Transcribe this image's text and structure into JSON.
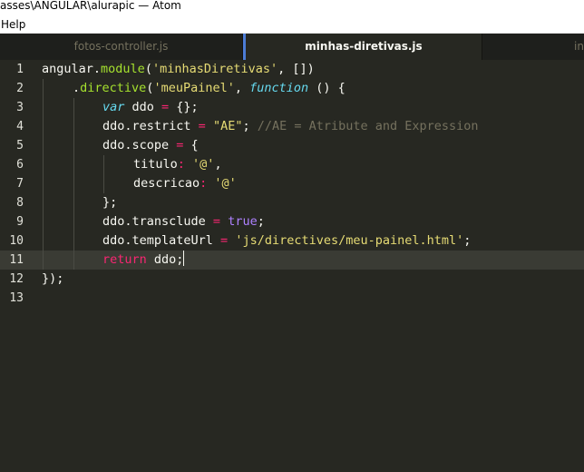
{
  "window": {
    "title": "asses\\ANGULAR\\alurapic — Atom"
  },
  "menu": {
    "items": [
      "Help"
    ]
  },
  "tabs": [
    {
      "label": "fotos-controller.js",
      "active": false
    },
    {
      "label": "minhas-diretivas.js",
      "active": true
    },
    {
      "label": "in",
      "active": false
    }
  ],
  "editor": {
    "line_numbers": [
      "1",
      "2",
      "3",
      "4",
      "5",
      "6",
      "7",
      "8",
      "9",
      "10",
      "11",
      "12",
      "13"
    ],
    "active_line": "11",
    "code": {
      "l1": [
        "angular",
        ".",
        "module",
        "(",
        "'minhasDiretivas'",
        ", [])"
      ],
      "l2": [
        ".",
        "directive",
        "(",
        "'meuPainel'",
        ", ",
        "function",
        " () {"
      ],
      "l3": [
        "var",
        " ddo ",
        "=",
        " {};"
      ],
      "l4": [
        "ddo.restrict ",
        "=",
        " ",
        "\"AE\"",
        "; ",
        "//AE = Atribute and Expression"
      ],
      "l5": [
        "ddo.scope ",
        "=",
        " {"
      ],
      "l6": [
        "titulo",
        ": ",
        "'@'",
        ","
      ],
      "l7": [
        "descricao",
        ": ",
        "'@'"
      ],
      "l8": [
        "};"
      ],
      "l9": [
        "ddo.transclude ",
        "=",
        " ",
        "true",
        ";"
      ],
      "l10": [
        "ddo.templateUrl ",
        "=",
        " ",
        "'js/directives/meu-painel.html'",
        ";"
      ],
      "l11": [
        "return",
        " ddo;"
      ],
      "l12": [
        "});"
      ]
    }
  },
  "colors": {
    "background": "#272822",
    "keyword": "#f92672",
    "function": "#a6e22e",
    "string": "#e6db74",
    "comment": "#75715e",
    "storage": "#66d9ef",
    "boolean": "#ae81ff",
    "active_tab_marker": "#4c7cd6"
  }
}
